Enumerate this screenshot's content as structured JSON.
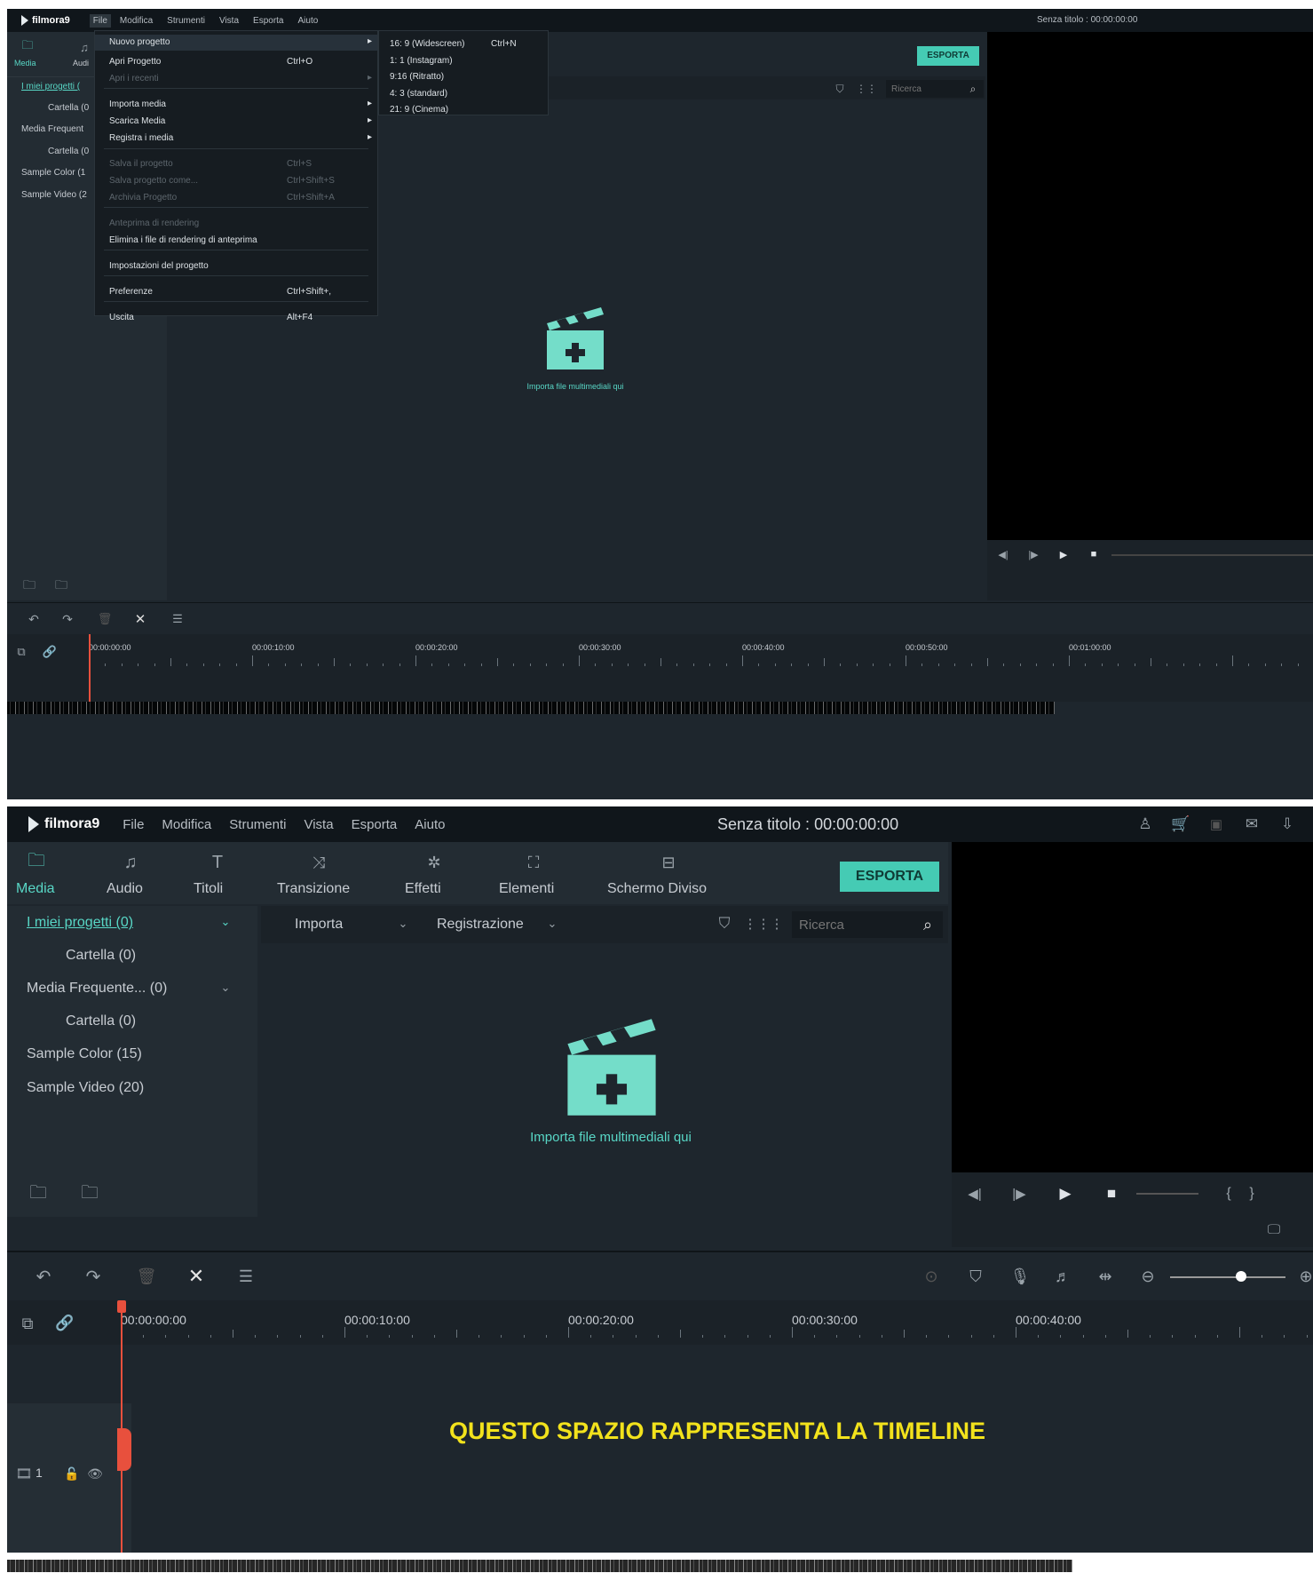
{
  "app": {
    "logo": "filmora9",
    "title": "Senza titolo : 00:00:00:00"
  },
  "menus": [
    "File",
    "Modifica",
    "Strumenti",
    "Vista",
    "Esporta",
    "Aiuto"
  ],
  "tabs": [
    "Media",
    "Audio",
    "Titoli",
    "Transizione",
    "Effetti",
    "Elementi",
    "Schermo Diviso"
  ],
  "tabs_small": [
    "Media",
    "Audi"
  ],
  "export_label": "ESPORTA",
  "toolbar": {
    "import": "Importa",
    "record": "Registrazione",
    "search_placeholder": "Ricerca"
  },
  "sidebar": {
    "items": [
      "I miei progetti (0)",
      "Cartella (0)",
      "Media Frequente... (0)",
      "Cartella (0)",
      "Sample Color (15)",
      "Sample Video (20)"
    ],
    "items_small": [
      "I miei progetti (",
      "Cartella (0",
      "Media Frequent",
      "Cartella (0",
      "Sample Color (1",
      "Sample Video (2"
    ]
  },
  "empty_state": "Importa file multimediali qui",
  "file_menu": {
    "items": [
      {
        "label": "Nuovo progetto",
        "shortcut": "",
        "sub": true,
        "disabled": false
      },
      {
        "label": "Apri Progetto",
        "shortcut": "Ctrl+O",
        "sub": false,
        "disabled": false
      },
      {
        "label": "Apri i recenti",
        "shortcut": "",
        "sub": true,
        "disabled": true
      },
      {
        "label": "Importa media",
        "shortcut": "",
        "sub": true,
        "disabled": false
      },
      {
        "label": "Scarica Media",
        "shortcut": "",
        "sub": true,
        "disabled": false
      },
      {
        "label": "Registra i media",
        "shortcut": "",
        "sub": true,
        "disabled": false
      },
      {
        "label": "Salva il progetto",
        "shortcut": "Ctrl+S",
        "sub": false,
        "disabled": true
      },
      {
        "label": "Salva progetto come...",
        "shortcut": "Ctrl+Shift+S",
        "sub": false,
        "disabled": true
      },
      {
        "label": "Archivia Progetto",
        "shortcut": "Ctrl+Shift+A",
        "sub": false,
        "disabled": true
      },
      {
        "label": "Anteprima di rendering",
        "shortcut": "",
        "sub": false,
        "disabled": true
      },
      {
        "label": "Elimina i file di rendering di anteprima",
        "shortcut": "",
        "sub": false,
        "disabled": false
      },
      {
        "label": "Impostazioni del progetto",
        "shortcut": "",
        "sub": false,
        "disabled": false
      },
      {
        "label": "Preferenze",
        "shortcut": "Ctrl+Shift+,",
        "sub": false,
        "disabled": false
      },
      {
        "label": "Uscita",
        "shortcut": "Alt+F4",
        "sub": false,
        "disabled": false
      }
    ],
    "submenu": [
      {
        "label": "16: 9 (Widescreen)",
        "shortcut": "Ctrl+N"
      },
      {
        "label": "1: 1 (Instagram)",
        "shortcut": ""
      },
      {
        "label": "9:16 (Ritratto)",
        "shortcut": ""
      },
      {
        "label": "4: 3 (standard)",
        "shortcut": ""
      },
      {
        "label": "21: 9 (Cinema)",
        "shortcut": ""
      }
    ]
  },
  "timeline": {
    "top_ticks": [
      "00:00:00:00",
      "00:00:10:00",
      "00:00:20:00",
      "00:00:30:00",
      "00:00:40:00",
      "00:00:50:00",
      "00:01:00:00"
    ],
    "bottom_ticks": [
      "00:00:00:00",
      "00:00:10:00",
      "00:00:20:00",
      "00:00:30:00",
      "00:00:40:00"
    ],
    "caption": "QUESTO SPAZIO RAPPRESENTA LA TIMELINE",
    "track_number": "1"
  },
  "colors": {
    "accent": "#45cbb4",
    "caption": "#f2e21c",
    "playhead": "#e8503d",
    "background": "#1e262d"
  }
}
